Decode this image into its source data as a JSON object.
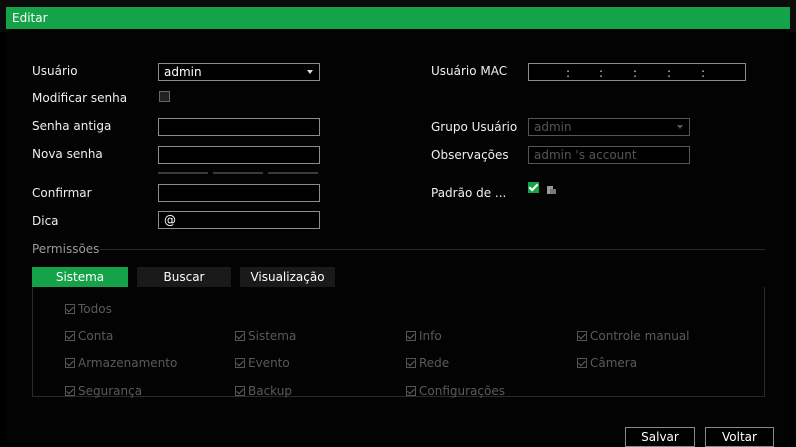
{
  "window": {
    "title": "Editar"
  },
  "form": {
    "user_label": "Usuário",
    "user_value": "admin",
    "modify_label": "Modificar senha",
    "old_pw_label": "Senha antiga",
    "new_pw_label": "Nova senha",
    "confirm_label": "Confirmar",
    "hint_label": "Dica",
    "hint_value": "@",
    "mac_label": "Usuário MAC",
    "mac_sep": ":",
    "group_label": "Grupo Usuário",
    "group_value": "admin",
    "notes_label": "Observações",
    "notes_placeholder": "admin 's account",
    "default_label": "Padrão de ..."
  },
  "permissions": {
    "section_label": "Permissões",
    "tabs": [
      "Sistema",
      "Buscar",
      "Visualização"
    ],
    "items": [
      "Todos",
      "Conta",
      "Sistema",
      "Info",
      "Controle manual",
      "Armazenamento",
      "Evento",
      "Rede",
      "Câmera",
      "Segurança",
      "Backup",
      "Configurações"
    ]
  },
  "buttons": {
    "save": "Salvar",
    "back": "Voltar"
  },
  "colors": {
    "accent": "#15a34a"
  }
}
